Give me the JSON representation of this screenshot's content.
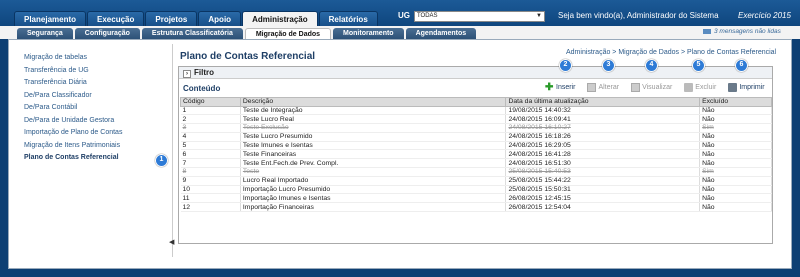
{
  "main_nav": [
    "Planejamento",
    "Execução",
    "Projetos",
    "Apoio",
    "Administração",
    "Relatórios"
  ],
  "ug": {
    "label": "UG",
    "value": "TODAS"
  },
  "welcome": "Seja bem vindo(a), Administrador do Sistema",
  "exercise": "Exercício 2015",
  "sub_nav": [
    "Segurança",
    "Configuração",
    "Estrutura Classificatória",
    "Migração de Dados",
    "Monitoramento",
    "Agendamentos"
  ],
  "messages": "3 mensagens não lidas",
  "sidebar": [
    "Migração de tabelas",
    "Transferência de UG",
    "Transferência Diária",
    "De/Para Classificador",
    "De/Para Contábil",
    "De/Para de Unidade Gestora",
    "Importação de Plano de Contas",
    "Migração de Itens Patrimoniais",
    "Plano de Contas Referencial"
  ],
  "page_title": "Plano de Contas Referencial",
  "breadcrumb": "Administração > Migração de Dados > Plano de Contas Referencial",
  "filter_label": "Filtro",
  "content_label": "Conteúdo",
  "toolbar": {
    "insert": "Inserir",
    "edit": "Alterar",
    "view": "Visualizar",
    "delete": "Excluir",
    "print": "Imprimir"
  },
  "table": {
    "headers": [
      "Código",
      "Descrição",
      "Data da última atualização",
      "Excluído"
    ],
    "rows": [
      [
        "1",
        "Teste de Integração",
        "19/08/2015 14:40:32",
        "Não"
      ],
      [
        "2",
        "Teste Lucro Real",
        "24/08/2015 16:09:41",
        "Não"
      ],
      [
        "3",
        "Teste Exclusão",
        "24/08/2015 16:10:27",
        "Sim"
      ],
      [
        "4",
        "Teste Lucro Presumido",
        "24/08/2015 16:18:26",
        "Não"
      ],
      [
        "5",
        "Teste Imunes e Isentas",
        "24/08/2015 16:29:05",
        "Não"
      ],
      [
        "6",
        "Teste Financeiras",
        "24/08/2015 16:41:28",
        "Não"
      ],
      [
        "7",
        "Teste Ent.Fech.de Prev. Compl.",
        "24/08/2015 16:51:30",
        "Não"
      ],
      [
        "8",
        "Teste",
        "25/08/2015 15:40:53",
        "Sim"
      ],
      [
        "9",
        "Lucro Real Importado",
        "25/08/2015 15:44:22",
        "Não"
      ],
      [
        "10",
        "Importação Lucro Presumido",
        "25/08/2015 15:50:31",
        "Não"
      ],
      [
        "11",
        "Importação Imunes e Isentas",
        "26/08/2015 12:45:15",
        "Não"
      ],
      [
        "12",
        "Importação Financeiras",
        "26/08/2015 12:54:04",
        "Não"
      ]
    ]
  },
  "badges": [
    "1",
    "2",
    "3",
    "4",
    "5",
    "6"
  ]
}
